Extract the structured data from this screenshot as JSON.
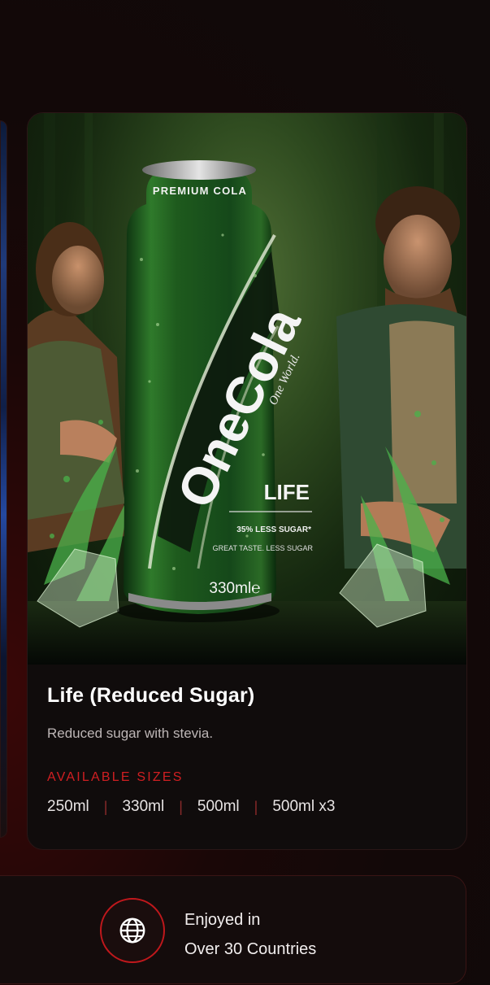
{
  "product": {
    "can": {
      "premium_text": "PREMIUM COLA",
      "brand": "OneCola",
      "tagline": "One World.",
      "variant": "LIFE",
      "claim": "35% LESS SUGAR*",
      "subclaim": "GREAT TASTE. LESS SUGAR",
      "volume": "330ml℮"
    },
    "title": "Life (Reduced Sugar)",
    "description": "Reduced sugar with stevia.",
    "sizes_label": "AVAILABLE SIZES",
    "sizes": [
      "250ml",
      "330ml",
      "500ml",
      "500ml x3"
    ]
  },
  "countries": {
    "icon": "globe-icon",
    "line1": "Enjoyed in",
    "line2": "Over 30 Countries"
  },
  "colors": {
    "accent": "#d11f22",
    "background": "#100a0a",
    "card": "#100c0c",
    "can_green": "#1f5a1c"
  }
}
